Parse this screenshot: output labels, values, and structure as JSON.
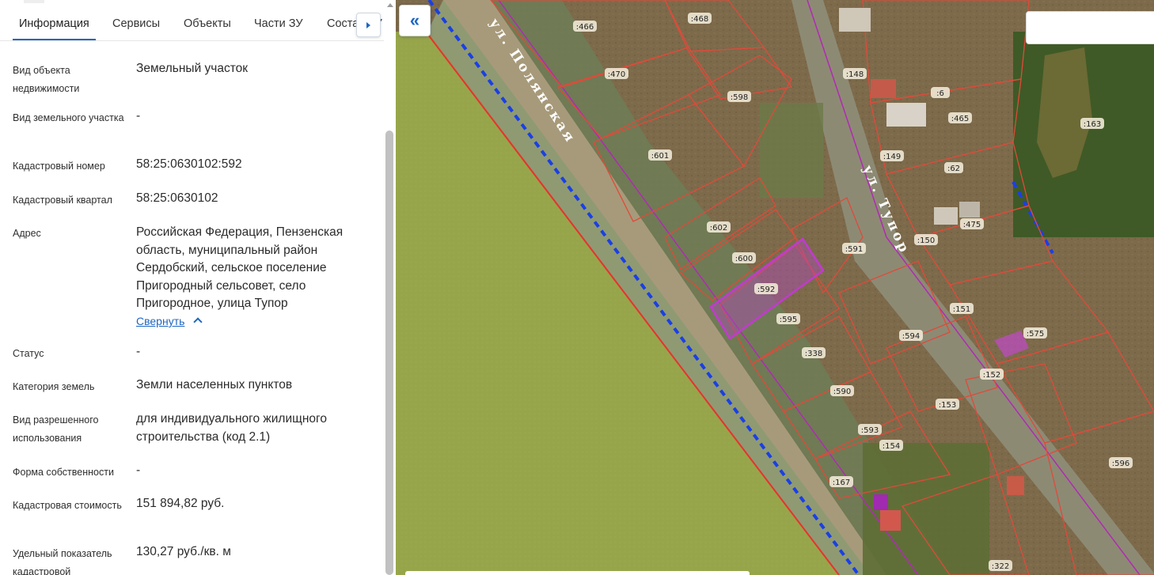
{
  "tabs": [
    {
      "label": "Информация",
      "active": true
    },
    {
      "label": "Сервисы"
    },
    {
      "label": "Объекты"
    },
    {
      "label": "Части ЗУ"
    },
    {
      "label": "Состав ЗУ"
    }
  ],
  "properties": [
    {
      "label": "Вид объекта недвижимости",
      "value": "Земельный участок"
    },
    {
      "label": "Вид земельного участка",
      "value": "-"
    },
    {
      "label": "Кадастровый номер",
      "value": "58:25:0630102:592"
    },
    {
      "label": "Кадастровый квартал",
      "value": "58:25:0630102"
    },
    {
      "label": "Адрес",
      "value": "Российская Федерация, Пензенская область, муниципальный район Сердобский, сельское поселение Пригородный сельсовет, село Пригородное, улица Тупор"
    },
    {
      "label": "Статус",
      "value": "-"
    },
    {
      "label": "Категория земель",
      "value": "Земли населенных пунктов"
    },
    {
      "label": "Вид разрешенного использования",
      "value": "для индивидуального жилищного строительства (код 2.1)"
    },
    {
      "label": "Форма собственности",
      "value": "-"
    },
    {
      "label": "Кадастровая стоимость",
      "value": "151 894,82 руб."
    },
    {
      "label": "Удельный показатель кадастровой",
      "value": "130,27 руб./кв. м"
    }
  ],
  "address_toggle": "Свернуть",
  "map": {
    "collapse_icon": "«",
    "street_labels": [
      "ул. Полянская",
      "ул. Тупор"
    ],
    "selected_parcel": ":592",
    "parcel_labels": [
      ":466",
      ":468",
      ":470",
      ":598",
      ":601",
      ":602",
      ":600",
      ":592",
      ":591",
      ":595",
      ":594",
      ":338",
      ":590",
      ":593",
      ":154",
      ":167",
      ":148",
      ":6",
      ":465",
      ":149",
      ":62",
      ":475",
      ":150",
      ":151",
      ":575",
      ":152",
      ":153",
      ":163",
      ":596",
      ":322"
    ],
    "search_placeholder": ""
  },
  "colors": {
    "accent": "#1f66c2",
    "selected_parcel_fill": "#b04ab8",
    "parcel_border": "#e04a3a",
    "boundary_line": "#1a3fe6"
  }
}
